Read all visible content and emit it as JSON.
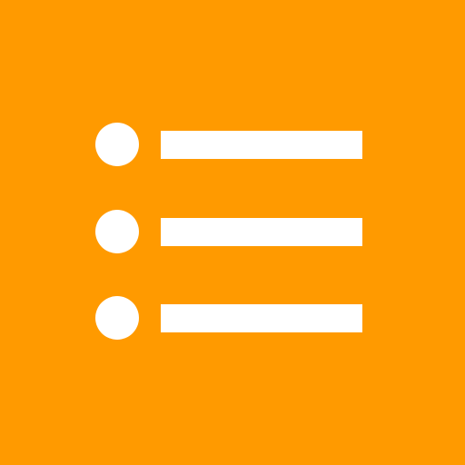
{
  "icon": {
    "name": "list-icon",
    "background_color": "#FF9A00",
    "foreground_color": "#FFFFFF",
    "rows": [
      {
        "name": "list-row"
      },
      {
        "name": "list-row"
      },
      {
        "name": "list-row"
      }
    ]
  }
}
